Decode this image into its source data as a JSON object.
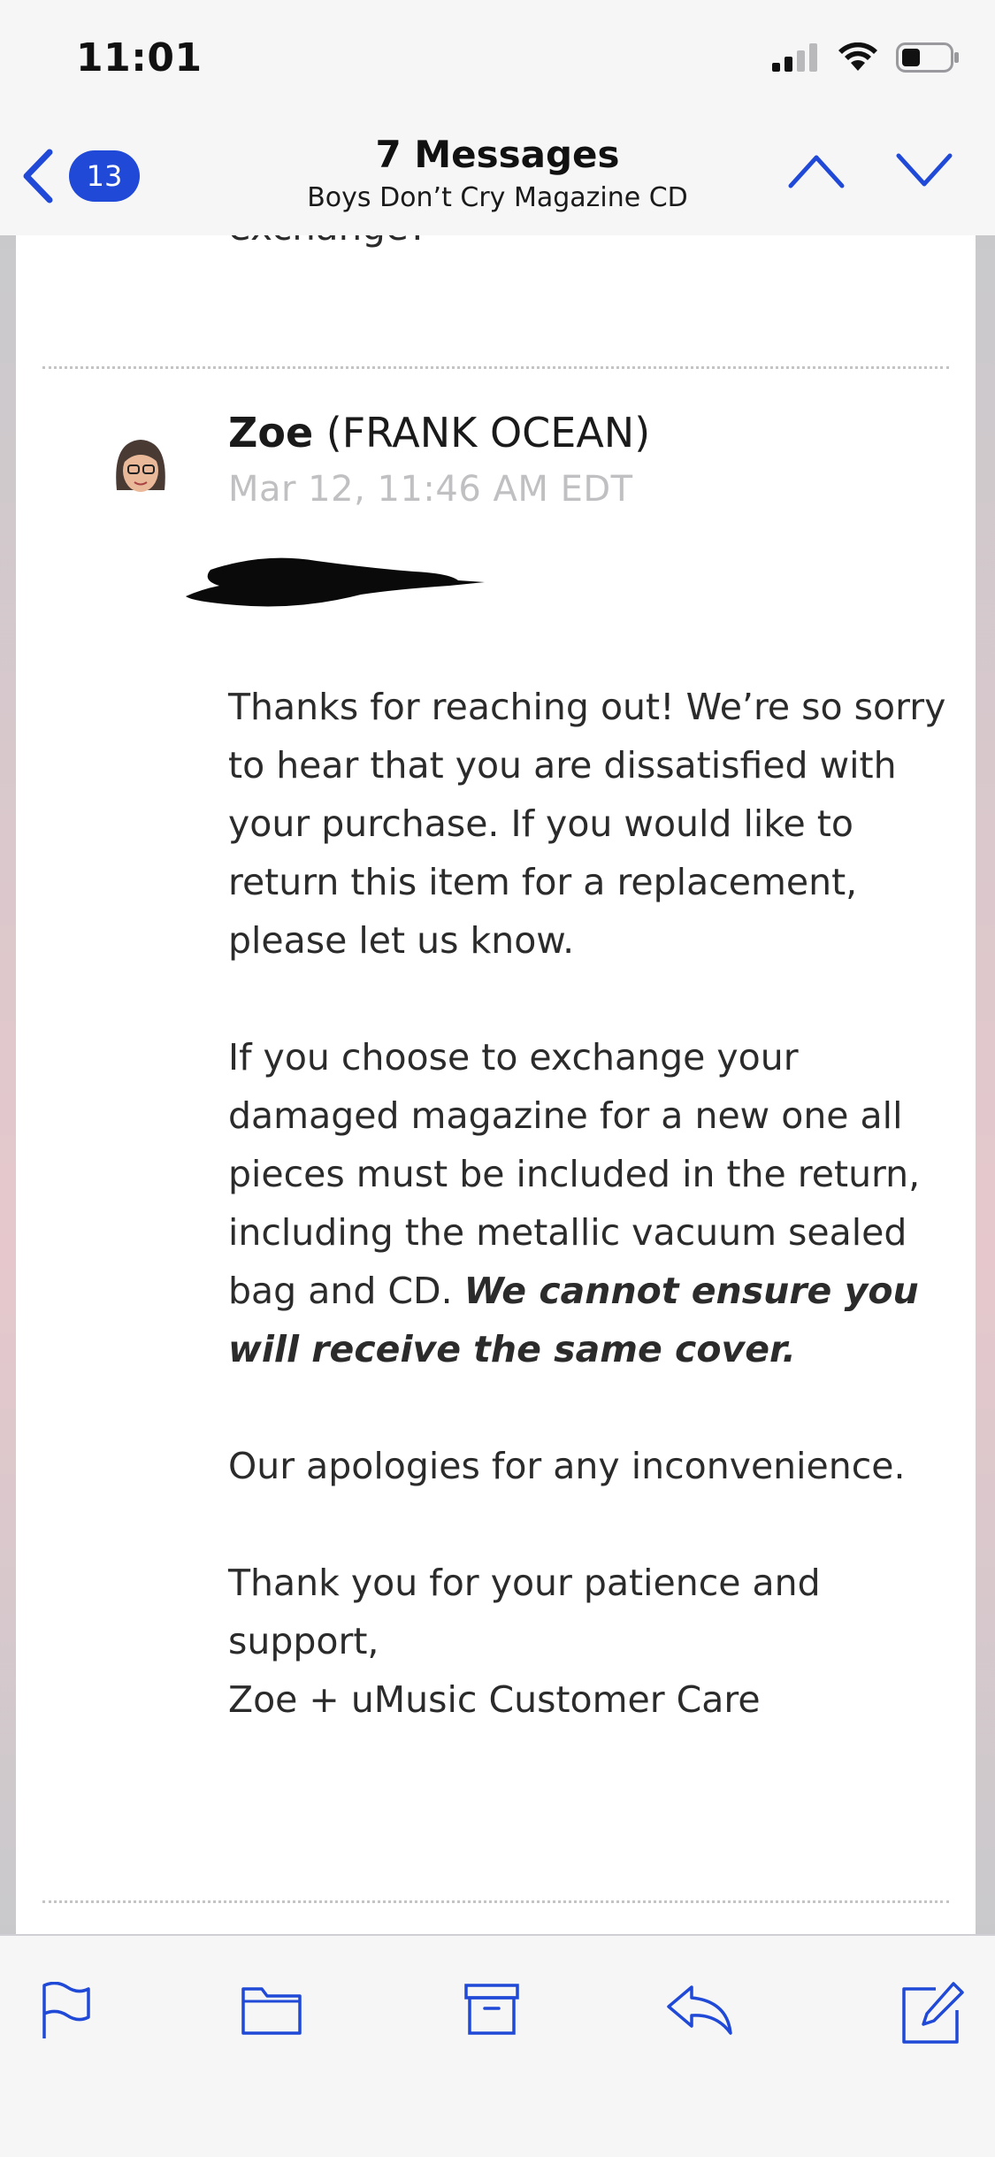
{
  "status_bar": {
    "time": "11:01"
  },
  "nav": {
    "back_count": "13",
    "title": "7 Messages",
    "subtitle": "Boys Don’t Cry Magazine CD"
  },
  "thread": {
    "previous_tail_text": "exchange?",
    "message": {
      "sender_name": "Zoe",
      "sender_org": "(FRANK OCEAN)",
      "date": "Mar 12, 11:46 AM EDT",
      "paragraph1": "Thanks for reaching out! We’re so sorry to hear that you are dissatisfied with your purchase. If you would like to return this item for a replacement, please let us know.",
      "paragraph2_plain": "If you choose to exchange your damaged magazine for a new one all pieces must be included in the return, including the metallic vacuum sealed bag and CD.",
      "paragraph2_emphasis": "We cannot ensure you will receive the same cover.",
      "paragraph3": "Our apologies for any inconvenience.",
      "closing": "Thank you for your patience and support,",
      "signature": "Zoe + uMusic Customer Care"
    }
  },
  "toolbar": {
    "icons": [
      "flag-icon",
      "folder-icon",
      "archive-icon",
      "reply-icon",
      "compose-icon"
    ]
  },
  "colors": {
    "accent": "#1f49d6",
    "badge_text": "#ffffff"
  }
}
